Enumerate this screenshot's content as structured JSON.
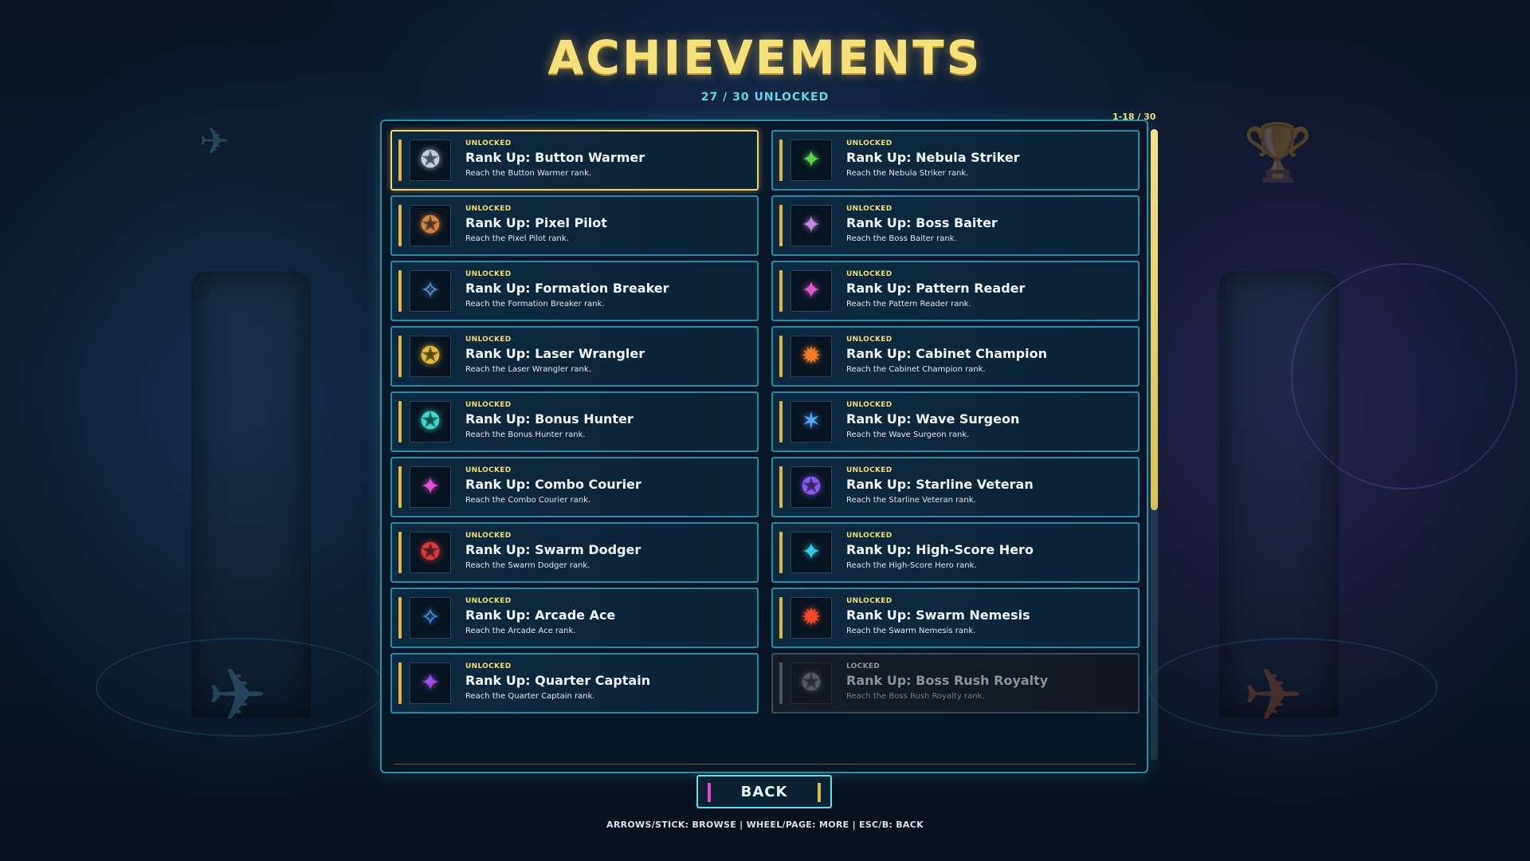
{
  "title": "ACHIEVEMENTS",
  "progress": "27 / 30 UNLOCKED",
  "page_range": "1-18 / 30",
  "colors": {
    "accent_gold": "#f2d36b",
    "cyan_border": "#1f8ea8",
    "background": "#0c1a2c"
  },
  "achievements": [
    {
      "status": "UNLOCKED",
      "name": "Rank Up: Button Warmer",
      "desc": "Reach the Button Warmer rank.",
      "icon": "silver-rank-emblem-icon",
      "glyph": "✪",
      "color": "#c8ced8"
    },
    {
      "status": "UNLOCKED",
      "name": "Rank Up: Nebula Striker",
      "desc": "Reach the Nebula Striker rank.",
      "icon": "green-rank-emblem-icon",
      "glyph": "✦",
      "color": "#5fd24a"
    },
    {
      "status": "UNLOCKED",
      "name": "Rank Up: Pixel Pilot",
      "desc": "Reach the Pixel Pilot rank.",
      "icon": "bronze-rank-emblem-icon",
      "glyph": "✪",
      "color": "#d8853c"
    },
    {
      "status": "UNLOCKED",
      "name": "Rank Up: Boss Baiter",
      "desc": "Reach the Boss Baiter rank.",
      "icon": "purple-gold-rank-emblem-icon",
      "glyph": "✦",
      "color": "#c08ae0"
    },
    {
      "status": "UNLOCKED",
      "name": "Rank Up: Formation Breaker",
      "desc": "Reach the Formation Breaker rank.",
      "icon": "blue-rank-emblem-icon",
      "glyph": "✧",
      "color": "#5aa0f0"
    },
    {
      "status": "UNLOCKED",
      "name": "Rank Up: Pattern Reader",
      "desc": "Reach the Pattern Reader rank.",
      "icon": "magenta-rank-emblem-icon",
      "glyph": "✦",
      "color": "#e05ad0"
    },
    {
      "status": "UNLOCKED",
      "name": "Rank Up: Laser Wrangler",
      "desc": "Reach the Laser Wrangler rank.",
      "icon": "gold-rank-emblem-icon",
      "glyph": "✪",
      "color": "#e8b83a"
    },
    {
      "status": "UNLOCKED",
      "name": "Rank Up: Cabinet Champion",
      "desc": "Reach the Cabinet Champion rank.",
      "icon": "orange-rank-emblem-icon",
      "glyph": "✹",
      "color": "#f07a28"
    },
    {
      "status": "UNLOCKED",
      "name": "Rank Up: Bonus Hunter",
      "desc": "Reach the Bonus Hunter rank.",
      "icon": "teal-rank-emblem-icon",
      "glyph": "✪",
      "color": "#3fd6c8"
    },
    {
      "status": "UNLOCKED",
      "name": "Rank Up: Wave Surgeon",
      "desc": "Reach the Wave Surgeon rank.",
      "icon": "blue-star-emblem-icon",
      "glyph": "✶",
      "color": "#58a8f8"
    },
    {
      "status": "UNLOCKED",
      "name": "Rank Up: Combo Courier",
      "desc": "Reach the Combo Courier rank.",
      "icon": "pink-rank-emblem-icon",
      "glyph": "✦",
      "color": "#e050d8"
    },
    {
      "status": "UNLOCKED",
      "name": "Rank Up: Starline Veteran",
      "desc": "Reach the Starline Veteran rank.",
      "icon": "violet-rank-emblem-icon",
      "glyph": "✪",
      "color": "#8a5ae8"
    },
    {
      "status": "UNLOCKED",
      "name": "Rank Up: Swarm Dodger",
      "desc": "Reach the Swarm Dodger rank.",
      "icon": "red-rank-emblem-icon",
      "glyph": "✪",
      "color": "#e03838"
    },
    {
      "status": "UNLOCKED",
      "name": "Rank Up: High-Score Hero",
      "desc": "Reach the High-Score Hero rank.",
      "icon": "cyan-rank-emblem-icon",
      "glyph": "✦",
      "color": "#38c8e0"
    },
    {
      "status": "UNLOCKED",
      "name": "Rank Up: Arcade Ace",
      "desc": "Reach the Arcade Ace rank.",
      "icon": "azure-rank-emblem-icon",
      "glyph": "✧",
      "color": "#4a98f0"
    },
    {
      "status": "UNLOCKED",
      "name": "Rank Up: Swarm Nemesis",
      "desc": "Reach the Swarm Nemesis rank.",
      "icon": "crimson-rank-emblem-icon",
      "glyph": "✹",
      "color": "#f04828"
    },
    {
      "status": "UNLOCKED",
      "name": "Rank Up: Quarter Captain",
      "desc": "Reach the Quarter Captain rank.",
      "icon": "purple-rank-emblem-icon",
      "glyph": "✦",
      "color": "#a050e8"
    },
    {
      "status": "LOCKED",
      "name": "Rank Up: Boss Rush Royalty",
      "desc": "Reach the Boss Rush Royalty rank.",
      "icon": "locked-rank-emblem-icon",
      "glyph": "✪",
      "color": "#9aa4ae"
    }
  ],
  "back_label": "BACK",
  "controls_hint": "ARROWS/STICK: BROWSE  |  WHEEL/PAGE: MORE  |  ESC/B: BACK"
}
